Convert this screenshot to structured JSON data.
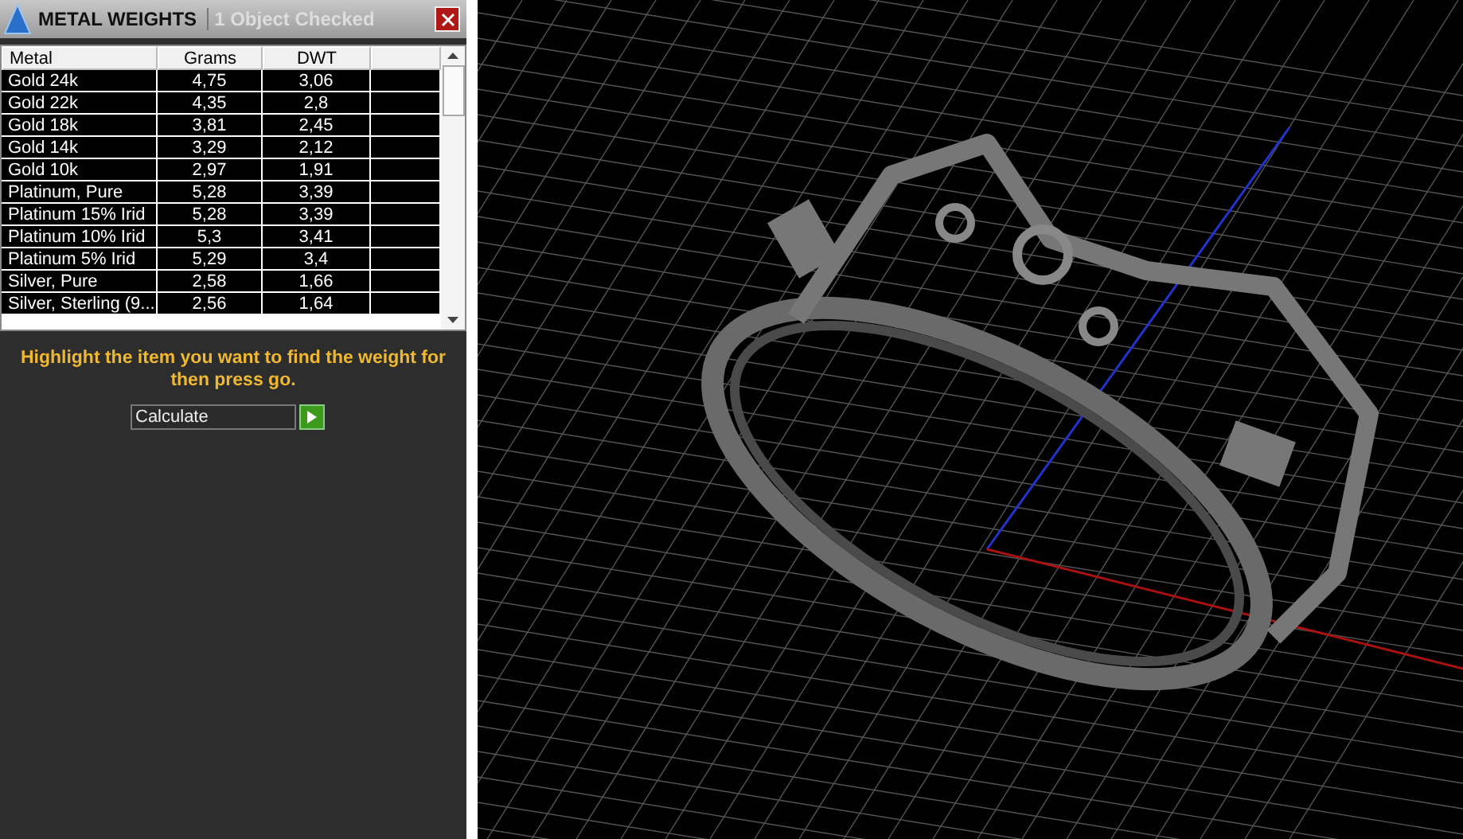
{
  "panel": {
    "title": "METAL WEIGHTS",
    "status": "1 Object Checked"
  },
  "table": {
    "columns": [
      "Metal",
      "Grams",
      "DWT"
    ],
    "rows": [
      {
        "cells": [
          "Gold 24k",
          "4,75",
          "3,06"
        ]
      },
      {
        "cells": [
          "Gold 22k",
          "4,35",
          "2,8"
        ]
      },
      {
        "cells": [
          "Gold 18k",
          "3,81",
          "2,45"
        ]
      },
      {
        "cells": [
          "Gold 14k",
          "3,29",
          "2,12"
        ]
      },
      {
        "cells": [
          "Gold 10k",
          "2,97",
          "1,91"
        ]
      },
      {
        "cells": [
          "Platinum, Pure",
          "5,28",
          "3,39"
        ]
      },
      {
        "cells": [
          "Platinum 15% Irid",
          "5,28",
          "3,39"
        ]
      },
      {
        "cells": [
          "Platinum 10% Irid",
          "5,3",
          "3,41"
        ]
      },
      {
        "cells": [
          "Platinum 5% Irid",
          "5,29",
          "3,4"
        ]
      },
      {
        "cells": [
          "Silver, Pure",
          "2,58",
          "1,66"
        ]
      },
      {
        "cells": [
          "Silver, Sterling (9...",
          "2,56",
          "1,64"
        ]
      }
    ]
  },
  "instruction": "Highlight the item you want to find the weight for then press go.",
  "dropdown": {
    "value": "Calculate"
  }
}
